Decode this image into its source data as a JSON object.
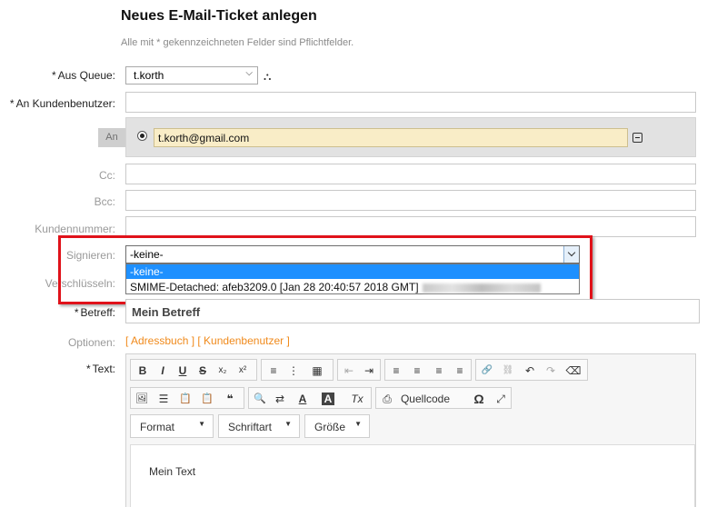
{
  "page": {
    "title": "Neues E-Mail-Ticket anlegen",
    "hint": "Alle mit * gekennzeichneten Felder sind Pflichtfelder."
  },
  "labels": {
    "required_mark": "*",
    "queue": "Aus Queue:",
    "customer_user": "An Kundenbenutzer:",
    "an": "An",
    "cc": "Cc:",
    "bcc": "Bcc:",
    "customer_number": "Kundennummer:",
    "sign": "Signieren:",
    "encrypt": "Verschlüsseln:",
    "subject": "Betreff:",
    "options": "Optionen:",
    "text": "Text:"
  },
  "queue": {
    "value": "t.korth"
  },
  "recipient": {
    "email": "t.korth@gmail.com"
  },
  "signing": {
    "selected": "-keine-",
    "options": [
      "-keine-",
      "SMIME-Detached: afeb3209.0 [Jan 28 20:40:57 2018 GMT]"
    ]
  },
  "subject": {
    "value": "Mein Betreff"
  },
  "options_links": "[ Adressbuch ] [ Kundenbenutzer ]",
  "editor": {
    "row1": [
      "B",
      "I",
      "U",
      "S",
      "x₂",
      "x²",
      "≡",
      "⋮",
      "▦",
      "⇤",
      "⇥",
      "≡",
      "≡",
      "≡",
      "≡",
      "🔗",
      "⛓",
      "↶",
      "↷",
      "⌫"
    ],
    "row2": [
      "🖼",
      "☰",
      "📋",
      "📋",
      "❝",
      "🔍",
      "⇄",
      "A",
      "A",
      "Tx",
      "⎙",
      "Quellcode",
      "Ω",
      "⤢"
    ],
    "format_label": "Format",
    "font_label": "Schriftart",
    "size_label": "Größe",
    "body_text": "Mein Text"
  },
  "colors": {
    "highlight_frame": "#e0121a",
    "selected_option": "#1e90ff",
    "link_orange": "#f08a1c",
    "email_bg": "#f9edc7"
  }
}
